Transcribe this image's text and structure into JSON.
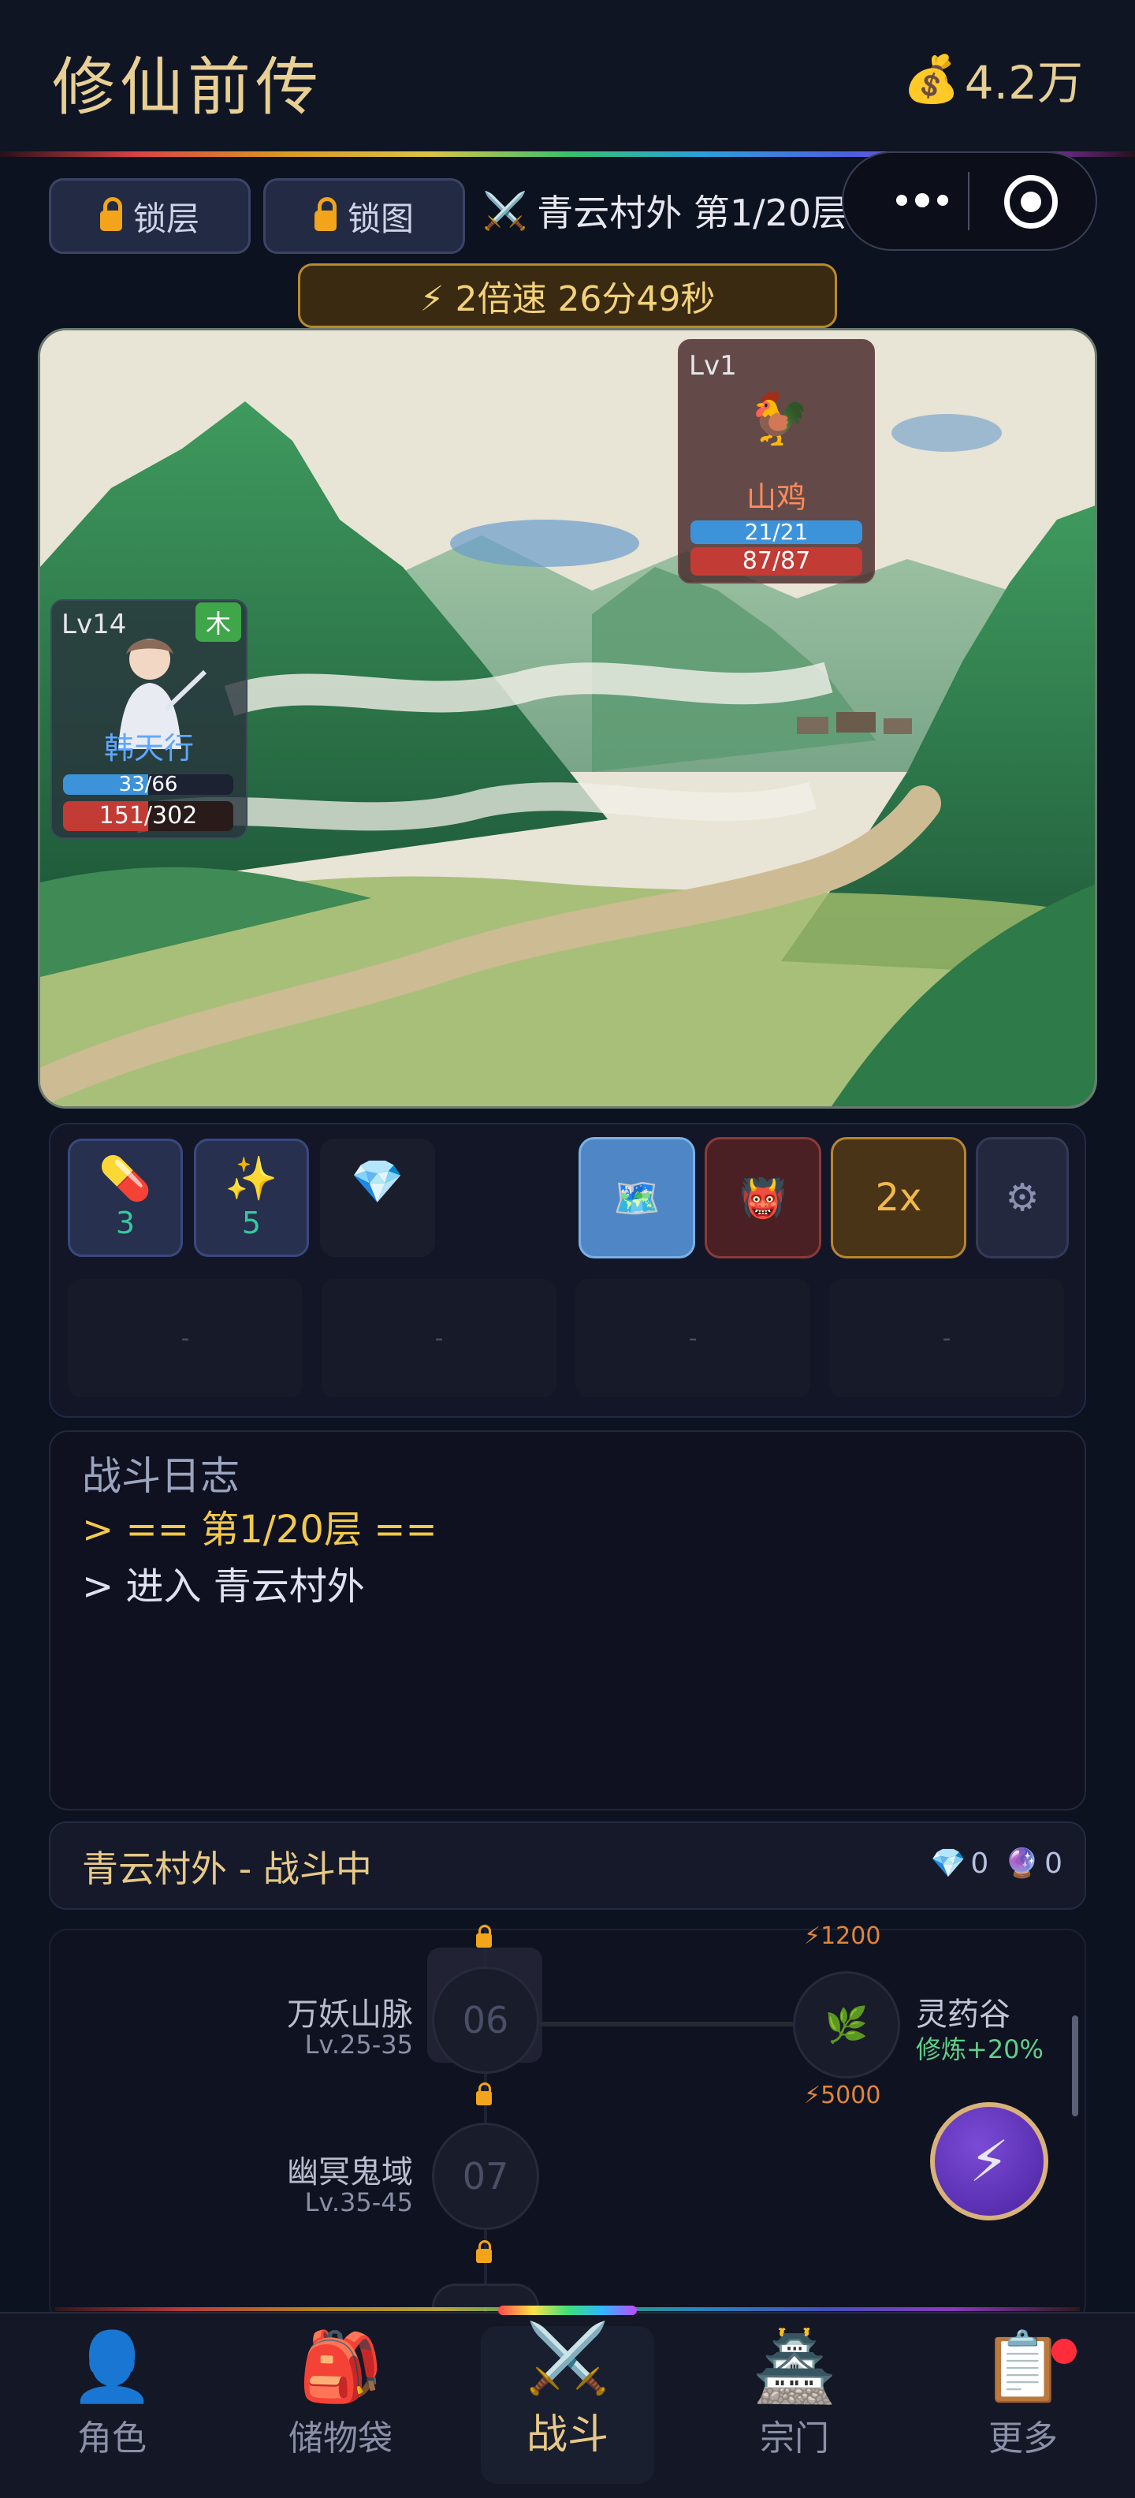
{
  "header": {
    "title": "修仙前传",
    "currency_icon": "money-bag-icon",
    "currency": "4.2万"
  },
  "toolbar": {
    "lock_floor": "锁层",
    "lock_map": "锁图",
    "stage_icon": "crossed-swords-icon",
    "stage": "青云村外 第1/20层",
    "speed_banner": "⚡ 2倍速 26分49秒"
  },
  "battle": {
    "enemy": {
      "level": "Lv1",
      "name": "山鸡",
      "icon": "rooster-icon",
      "mp_text": "21/21",
      "mp_fraction": 1.0,
      "hp_text": "87/87",
      "hp_fraction": 1.0
    },
    "player": {
      "level": "Lv14",
      "element": "木",
      "name": "韩天行",
      "mp_text": "33/66",
      "mp_fraction": 0.5,
      "hp_text": "151/302",
      "hp_fraction": 0.5
    }
  },
  "skills": {
    "pill_count": "3",
    "sparkle_count": "5",
    "speed_button": "2x",
    "empty_slot": "-"
  },
  "log": {
    "title": "战斗日志",
    "lines": [
      "> == 第1/20层 ==",
      "> 进入 青云村外"
    ]
  },
  "status": {
    "text": "青云村外 - 战斗中",
    "diamonds": "0",
    "orbs": "0"
  },
  "map": {
    "node_06": {
      "num": "06",
      "name": "万妖山脉",
      "lv": "Lv.25-35"
    },
    "node_07": {
      "num": "07",
      "name": "幽冥鬼域",
      "lv": "Lv.35-45"
    },
    "side_node": {
      "name": "灵药谷",
      "bonus": "修炼+20%",
      "cost_top": "⚡1200",
      "cost_bottom": "⚡5000"
    }
  },
  "tabs": [
    {
      "label": "角色",
      "icon": "person-icon"
    },
    {
      "label": "储物袋",
      "icon": "backpack-icon"
    },
    {
      "label": "战斗",
      "icon": "crossed-swords-icon"
    },
    {
      "label": "宗门",
      "icon": "pagoda-icon"
    },
    {
      "label": "更多",
      "icon": "clipboard-icon"
    }
  ],
  "colors": {
    "gold": "#e8cf94",
    "accent_orange": "#f2a51a",
    "hp_red": "#c23b34",
    "mp_blue": "#3c93d9"
  }
}
